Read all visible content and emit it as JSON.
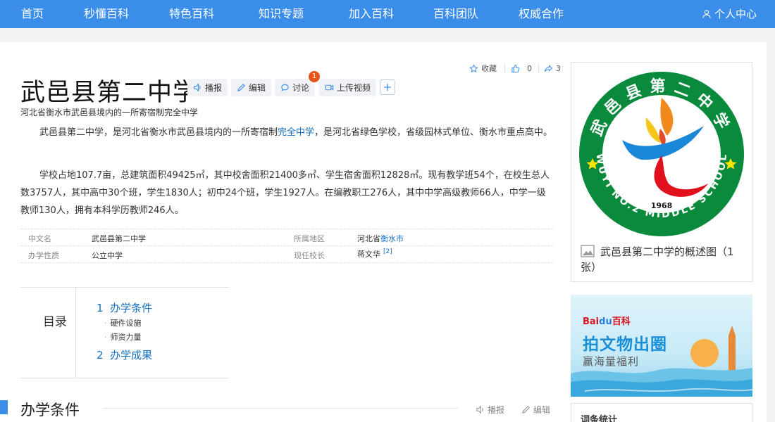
{
  "nav": {
    "items": [
      "首页",
      "秒懂百科",
      "特色百科",
      "知识专题",
      "加入百科",
      "百科团队",
      "权威合作"
    ],
    "user_center": "个人中心"
  },
  "header": {
    "title": "武邑县第二中学",
    "actions": {
      "broadcast": "播报",
      "edit": "编辑",
      "discuss": "讨论",
      "discuss_badge": "1",
      "upload_video": "上传视频"
    },
    "favorite": "收藏",
    "like_count": "0",
    "share_count": "3"
  },
  "summary": {
    "subtitle": "河北省衡水市武邑县境内的一所寄宿制完全中学",
    "para1_before": "武邑县第二中学，是河北省衡水市武邑县境内的一所寄宿制",
    "para1_link": "完全中学",
    "para1_after": "，是河北省绿色学校，省级园林式单位、衡水市重点高中。",
    "para2": "学校占地107.7亩，总建筑面积49425㎡，其中校舍面积21400多㎡、学生宿舍面积12828㎡。现有教学班54个，在校生总人数3757人，其中高中30个班，学生1830人；初中24个班，学生1927人。在编教职工276人，其中中学高级教师66人，中学一级教师130人，拥有本科学历教师246人。"
  },
  "infobox": {
    "chinese_name_key": "中文名",
    "chinese_name_val": "武邑县第二中学",
    "region_key": "所属地区",
    "region_prefix": "河北省",
    "region_link": "衡水市",
    "nature_key": "办学性质",
    "nature_val": "公立中学",
    "principal_key": "现任校长",
    "principal_val": "蒋文华",
    "principal_ref": "[2]"
  },
  "toc": {
    "label": "目录",
    "sections": [
      {
        "num": "1",
        "title": "办学条件",
        "subs": [
          "硬件设施",
          "师资力量"
        ]
      },
      {
        "num": "2",
        "title": "办学成果",
        "subs": []
      }
    ]
  },
  "section": {
    "title": "办学条件",
    "broadcast": "播报",
    "edit": "编辑"
  },
  "album": {
    "logo_top_text": "武邑县第二中学",
    "logo_bottom_text": "WUYI NO.2 MIDDLE SCHOOL",
    "logo_year": "1968",
    "caption": "武邑县第二中学的概述图（1张）"
  },
  "ad": {
    "brand_bai": "Bai",
    "brand_du": "du",
    "brand_baike": "百科",
    "headline": "拍文物出圈",
    "subline": "赢海量福利"
  },
  "stats": {
    "title": "词条统计"
  },
  "colors": {
    "nav_bg": "#3a8de8",
    "link": "#136ec2",
    "badge": "#e9541b",
    "logo_green": "#0a8a3c"
  }
}
